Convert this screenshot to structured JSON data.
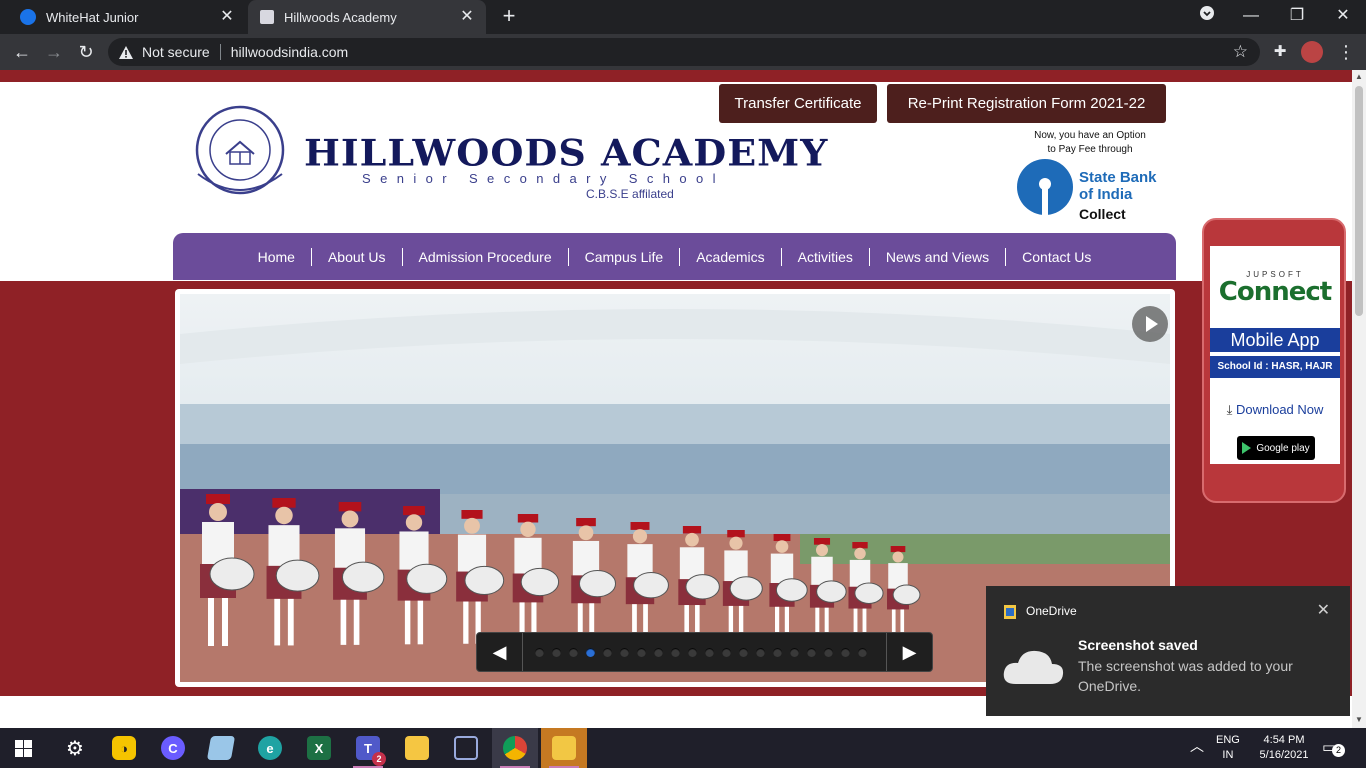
{
  "browser": {
    "tabs": [
      {
        "title": "WhiteHat Junior"
      },
      {
        "title": "Hillwoods Academy"
      }
    ],
    "security_label": "Not secure",
    "url": "hillwoodsindia.com"
  },
  "header": {
    "school_name": "HILLWOODS ACADEMY",
    "school_subtitle": "Senior Secondary School",
    "affiliation": "C.B.S.E affilated",
    "buttons": {
      "transfer_certificate": "Transfer Certificate",
      "reprint": "Re-Print Registration Form 2021-22"
    },
    "sbi": {
      "note_line1": "Now, you have an Option",
      "note_line2": "to Pay Fee through",
      "name_line1": "State Bank",
      "name_line2": "of India",
      "collect": "Collect"
    }
  },
  "nav": {
    "items": [
      {
        "label": "Home"
      },
      {
        "label": "About Us"
      },
      {
        "label": "Admission Procedure"
      },
      {
        "label": "Campus Life"
      },
      {
        "label": "Academics"
      },
      {
        "label": "Activities"
      },
      {
        "label": "News and Views"
      },
      {
        "label": "Contact Us"
      }
    ]
  },
  "slider": {
    "dot_count": 20,
    "active_index": 3
  },
  "app_widget": {
    "brand_small": "JUPSOFT",
    "brand_big": "Connect",
    "title": "Mobile App",
    "school_id": "School Id : HASR, HAJR",
    "download": "Download Now",
    "store_badge": "Google play"
  },
  "toast": {
    "app": "OneDrive",
    "title": "Screenshot saved",
    "body": "The screenshot was added to your OneDrive."
  },
  "taskbar": {
    "lang_line1": "ENG",
    "lang_line2": "IN",
    "time": "4:54 PM",
    "date": "5/16/2021",
    "notification_count": "2",
    "teams_badge": "2"
  },
  "colors": {
    "maroon": "#8f2126",
    "nav_purple": "#6b4c9a",
    "navy": "#13195c",
    "button_brown": "#4d1f1d"
  }
}
